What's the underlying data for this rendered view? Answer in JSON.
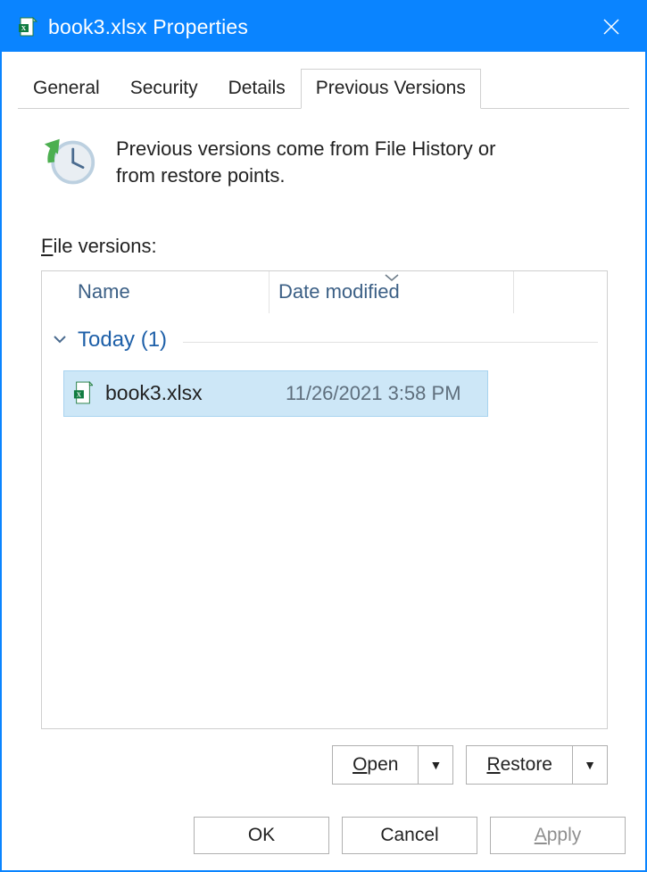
{
  "titlebar": {
    "title": "book3.xlsx Properties"
  },
  "tabs": {
    "general": "General",
    "security": "Security",
    "details": "Details",
    "previous_versions": "Previous Versions"
  },
  "info": {
    "text": "Previous versions come from File History or from restore points."
  },
  "labels": {
    "file_versions_prefix": "F",
    "file_versions_rest": "ile versions:"
  },
  "columns": {
    "name": "Name",
    "date": "Date modified"
  },
  "group": {
    "label": "Today (1)"
  },
  "items": [
    {
      "name": "book3.xlsx",
      "date": "11/26/2021 3:58 PM"
    }
  ],
  "actions": {
    "open_prefix": "O",
    "open_rest": "pen",
    "restore_prefix": "R",
    "restore_rest": "estore"
  },
  "buttons": {
    "ok": "OK",
    "cancel": "Cancel",
    "apply_prefix": "A",
    "apply_rest": "pply"
  }
}
